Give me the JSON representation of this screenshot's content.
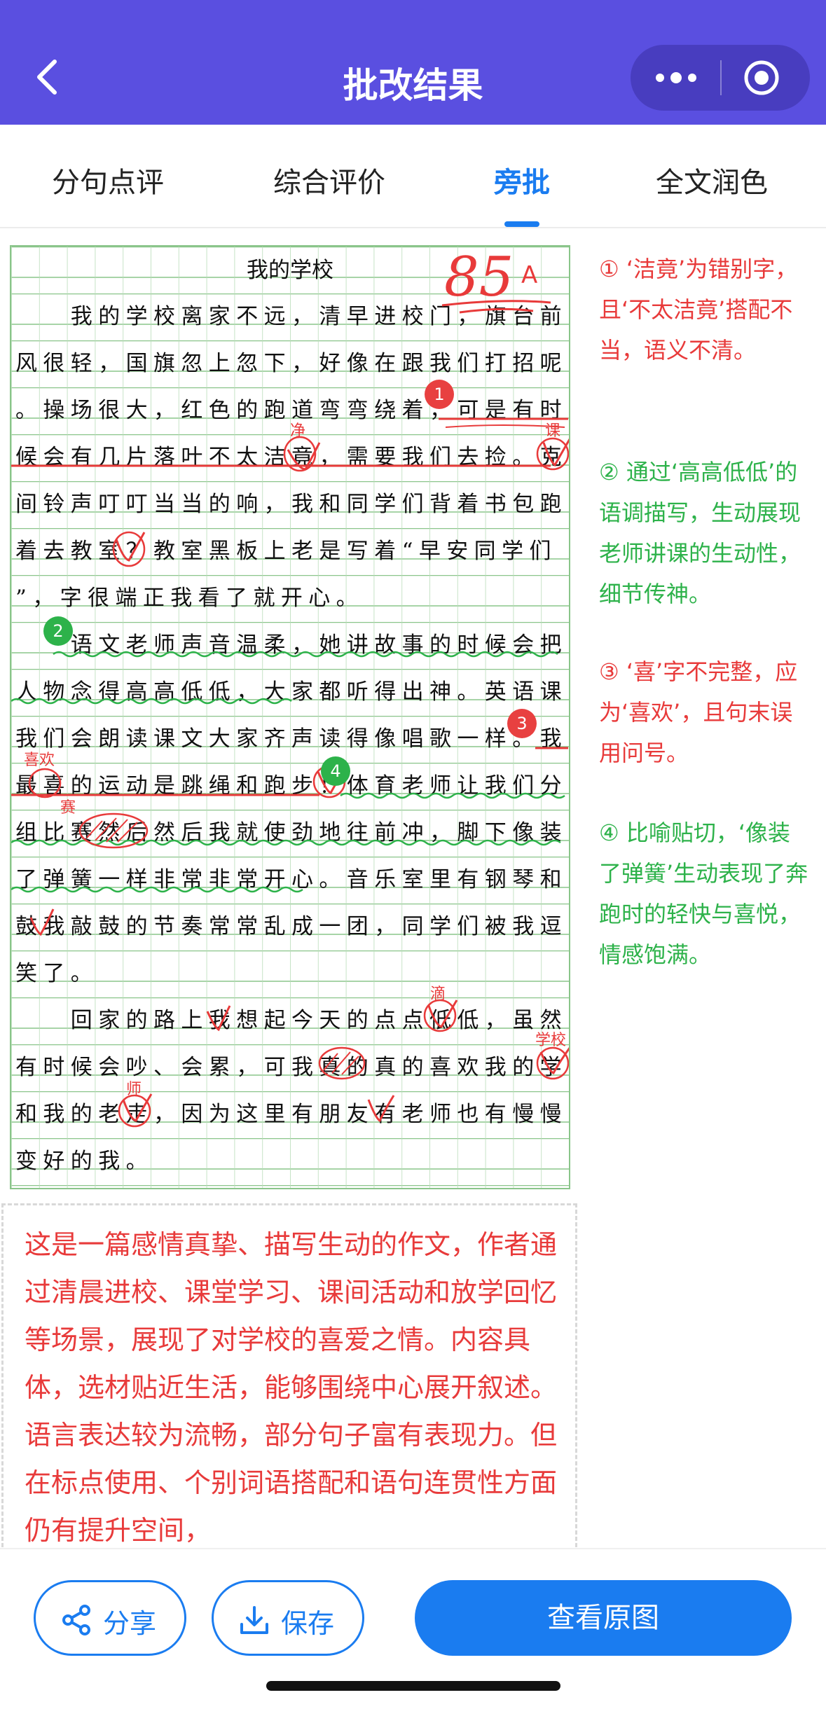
{
  "header": {
    "title": "批改结果"
  },
  "tabs": [
    {
      "label": "分句点评"
    },
    {
      "label": "综合评价"
    },
    {
      "label": "旁批"
    },
    {
      "label": "全文润色"
    }
  ],
  "essay": {
    "title": "我的学校",
    "score": "85",
    "grade": "A",
    "lines": [
      "　　我的学校离家不远，清早进校门，旗台前",
      "风很轻，国旗忽上忽下，好像在跟我们打招呢",
      "。操场很大，红色的跑道弯弯绕着，可是有时",
      "候会有几片落叶不太洁竟，需要我们去捡。克",
      "间铃声叮叮当当的响，我和同学们背着书包跑",
      "着去教室？教室黑板上老是写着“早安同学们",
      "”，字很端正我看了就开心。",
      "　　语文老师声音温柔，她讲故事的时候会把",
      "人物念得高高低低，大家都听得出神。英语课",
      "我们会朗读课文大家齐声读得像唱歌一样。我",
      "最喜的运动是跳绳和跑步！体育老师让我们分",
      "组比赛然后然后我就使劲地往前冲，脚下像装",
      "了弹簧一样非常非常开心。音乐室里有钢琴和",
      "鼓我敲鼓的节奏常常乱成一团，同学们被我逗",
      "笑了。",
      "　　回家的路上我想起今天的点点低低，虽然",
      "有时候会吵、会累，可我真的真的喜欢我的学",
      "和我的老走，因为这里有朋友有老师也有慢慢",
      "变好的我。"
    ],
    "corrections": [
      "净",
      "课",
      "喜欢",
      "赛",
      "滴",
      "学校",
      "师"
    ],
    "badges": [
      "1",
      "2",
      "3",
      "4"
    ]
  },
  "comments": [
    {
      "text": "① ‘洁竟’为错别字，且‘不太洁竟’搭配不当，语义不清。",
      "color": "#e83a3a"
    },
    {
      "text": "② 通过‘高高低低’的语调描写，生动展现老师讲课的生动性，细节传神。",
      "color": "#2db24a"
    },
    {
      "text": "③ ‘喜’字不完整，应为‘喜欢’，且句末误用问号。",
      "color": "#e83a3a"
    },
    {
      "text": "④ 比喻贴切，‘像装了弹簧’生动表现了奔跑时的轻快与喜悦，情感饱满。",
      "color": "#2db24a"
    }
  ],
  "summary": "这是一篇感情真挚、描写生动的作文，作者通过清晨进校、课堂学习、课间活动和放学回忆等场景，展现了对学校的喜爱之情。内容具体，选材贴近生活，能够围绕中心展开叙述。语言表达较为流畅，部分句子富有表现力。但在标点使用、个别词语搭配和语句连贯性方面仍有提升空间，",
  "bottom": {
    "share_label": "分享",
    "save_label": "保存",
    "view_label": "查看原图"
  },
  "colors": {
    "header": "#5a4fe0",
    "accent": "#1a7cf0",
    "mark_red": "#e83a3a",
    "mark_green": "#2db24a"
  }
}
